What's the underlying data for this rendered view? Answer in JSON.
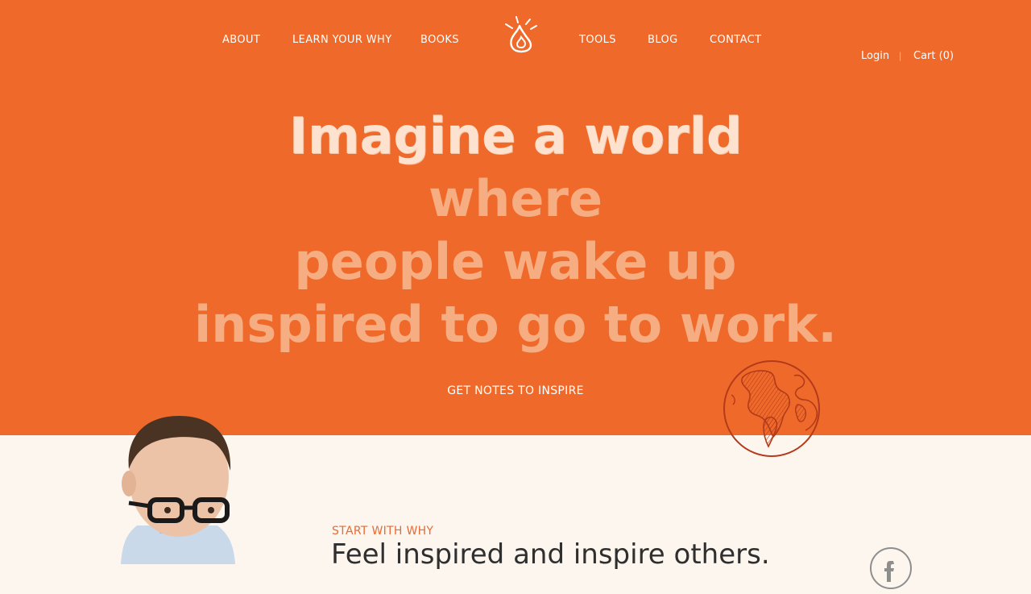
{
  "nav": {
    "left": [
      {
        "label": "ABOUT"
      },
      {
        "label": "LEARN YOUR WHY"
      },
      {
        "label": "BOOKS"
      }
    ],
    "right": [
      {
        "label": "TOOLS"
      },
      {
        "label": "BLOG"
      },
      {
        "label": "CONTACT"
      }
    ],
    "logo_icon": "flame-icon"
  },
  "utility": {
    "login_label": "Login",
    "separator": "|",
    "cart_label": "Cart (0)"
  },
  "hero": {
    "headline": {
      "line1_strong": "Imagine a world",
      "line1_soft": " where",
      "line2": "people wake up",
      "line3": "inspired to go to work."
    },
    "cta_label": "GET NOTES TO INSPIRE",
    "globe_icon": "globe-icon"
  },
  "section": {
    "label": "START WITH WHY",
    "title": "Feel inspired and inspire others.",
    "social_icon": "facebook-icon"
  },
  "colors": {
    "hero_background": "#ef6a2a",
    "page_background": "#fdf6ef",
    "accent": "#e86a34",
    "headline_strong": "#fde3cf",
    "headline_soft": "#f7ad82"
  }
}
